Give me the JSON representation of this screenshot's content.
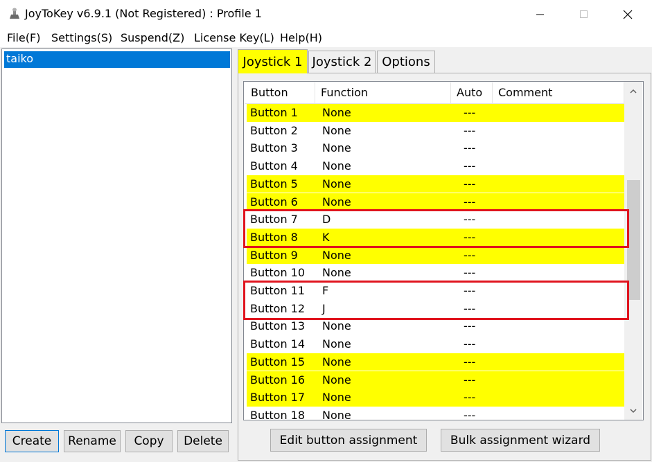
{
  "window": {
    "title": "JoyToKey v6.9.1 (Not Registered) : Profile 1",
    "controls": {
      "minimize": "—",
      "maximize": "☐",
      "close": "✕"
    }
  },
  "menu": [
    "File(F)",
    "Settings(S)",
    "Suspend(Z)",
    "License Key(L)",
    "Help(H)"
  ],
  "profiles": {
    "items": [
      "taiko"
    ],
    "selected": "taiko"
  },
  "profile_buttons": {
    "create": "Create",
    "rename": "Rename",
    "copy": "Copy",
    "delete": "Delete"
  },
  "tabs": {
    "active": "Joystick 1",
    "items": [
      "Joystick 1",
      "Joystick 2",
      "Options"
    ]
  },
  "table": {
    "headers": {
      "button": "Button",
      "function": "Function",
      "auto": "Auto",
      "comment": "Comment"
    },
    "rows": [
      {
        "button": "Button 1",
        "function": "None",
        "auto": "---",
        "comment": "",
        "highlight": true
      },
      {
        "button": "Button 2",
        "function": "None",
        "auto": "---",
        "comment": "",
        "highlight": false
      },
      {
        "button": "Button 3",
        "function": "None",
        "auto": "---",
        "comment": "",
        "highlight": false
      },
      {
        "button": "Button 4",
        "function": "None",
        "auto": "---",
        "comment": "",
        "highlight": false
      },
      {
        "button": "Button 5",
        "function": "None",
        "auto": "---",
        "comment": "",
        "highlight": true
      },
      {
        "button": "Button 6",
        "function": "None",
        "auto": "---",
        "comment": "",
        "highlight": true
      },
      {
        "button": "Button 7",
        "function": "D",
        "auto": "---",
        "comment": "",
        "highlight": false
      },
      {
        "button": "Button 8",
        "function": "K",
        "auto": "---",
        "comment": "",
        "highlight": true
      },
      {
        "button": "Button 9",
        "function": "None",
        "auto": "---",
        "comment": "",
        "highlight": true
      },
      {
        "button": "Button 10",
        "function": "None",
        "auto": "---",
        "comment": "",
        "highlight": false
      },
      {
        "button": "Button 11",
        "function": "F",
        "auto": "---",
        "comment": "",
        "highlight": false
      },
      {
        "button": "Button 12",
        "function": "J",
        "auto": "---",
        "comment": "",
        "highlight": false
      },
      {
        "button": "Button 13",
        "function": "None",
        "auto": "---",
        "comment": "",
        "highlight": false
      },
      {
        "button": "Button 14",
        "function": "None",
        "auto": "---",
        "comment": "",
        "highlight": false
      },
      {
        "button": "Button 15",
        "function": "None",
        "auto": "---",
        "comment": "",
        "highlight": true
      },
      {
        "button": "Button 16",
        "function": "None",
        "auto": "---",
        "comment": "",
        "highlight": true
      },
      {
        "button": "Button 17",
        "function": "None",
        "auto": "---",
        "comment": "",
        "highlight": true
      },
      {
        "button": "Button 18",
        "function": "None",
        "auto": "---",
        "comment": "",
        "highlight": false
      }
    ]
  },
  "actions": {
    "edit": "Edit button assignment",
    "bulk": "Bulk assignment wizard"
  },
  "colors": {
    "highlight": "#ffff00",
    "selection": "#0078d7",
    "annotation_box": "#e0141e"
  },
  "scroll": {
    "up_icon": "chevron-up-icon",
    "down_icon": "chevron-down-icon"
  }
}
